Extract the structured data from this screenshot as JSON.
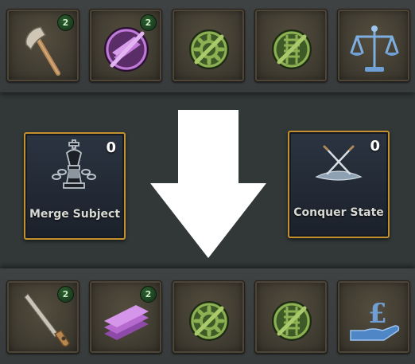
{
  "top_row": [
    {
      "icon": "axe-icon",
      "badge": "2"
    },
    {
      "icon": "purple-plates-crossed-icon",
      "badge": "2"
    },
    {
      "icon": "gear-crossed-icon"
    },
    {
      "icon": "railway-crossed-icon"
    },
    {
      "icon": "scales-icon"
    }
  ],
  "cards": {
    "merge": {
      "count": "0",
      "label": "Merge Subject",
      "icon": "chess-king-chains-icon"
    },
    "conquer": {
      "count": "0",
      "label": "Conquer State",
      "icon": "crossed-swords-icon"
    }
  },
  "bottom_row": [
    {
      "icon": "saw-icon",
      "badge": "2"
    },
    {
      "icon": "purple-plates-icon",
      "badge": "2"
    },
    {
      "icon": "gear-crossed-icon"
    },
    {
      "icon": "railway-crossed-icon"
    },
    {
      "icon": "pound-hand-icon"
    }
  ],
  "colors": {
    "card_border": "#c3902f",
    "badge_green": "#2c5e2e",
    "crossed_icon_green": "#7ba048",
    "purple": "#b66ad0",
    "blue": "#6f9fd4"
  }
}
